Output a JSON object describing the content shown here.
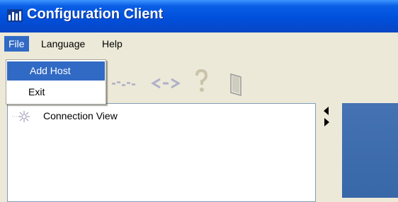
{
  "window": {
    "title": "Configuration Client"
  },
  "menubar": {
    "items": [
      {
        "label": "File"
      },
      {
        "label": "Language"
      },
      {
        "label": "Help"
      }
    ]
  },
  "file_menu": {
    "items": [
      {
        "label": "Add Host"
      },
      {
        "label": "Exit"
      }
    ]
  },
  "toolbar": {
    "icons": [
      "connect-icon",
      "disconnect-icon",
      "help-icon",
      "exit-door-icon"
    ]
  },
  "tree": {
    "nodes": [
      {
        "label": "Connection View",
        "icon": "network-icon"
      }
    ]
  },
  "colors": {
    "title_bar": "#0050dc",
    "menu_highlight": "#316ac5",
    "panel_blue": "#3d6dad",
    "window_bg": "#ece9d8"
  }
}
